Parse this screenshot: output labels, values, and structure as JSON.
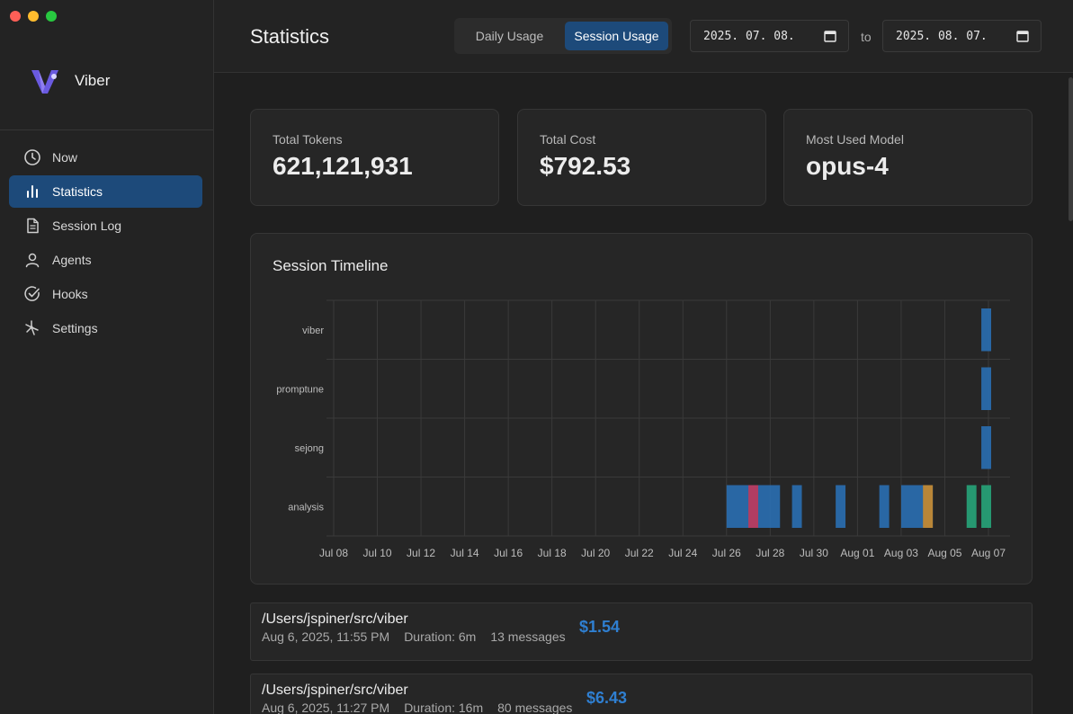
{
  "app": {
    "name": "Viber"
  },
  "sidebar": {
    "items": [
      {
        "label": "Now",
        "icon": "clock-icon",
        "active": false
      },
      {
        "label": "Statistics",
        "icon": "bar-chart-icon",
        "active": true
      },
      {
        "label": "Session Log",
        "icon": "document-icon",
        "active": false
      },
      {
        "label": "Agents",
        "icon": "user-icon",
        "active": false
      },
      {
        "label": "Hooks",
        "icon": "check-circle-icon",
        "active": false
      },
      {
        "label": "Settings",
        "icon": "settings-icon",
        "active": false
      }
    ]
  },
  "header": {
    "title": "Statistics",
    "tabs": [
      {
        "label": "Daily Usage",
        "active": false
      },
      {
        "label": "Session Usage",
        "active": true
      }
    ],
    "date_from": "2025. 07. 08.",
    "date_to": "2025. 08. 07.",
    "to_label": "to"
  },
  "cards": [
    {
      "label": "Total Tokens",
      "value": "621,121,931"
    },
    {
      "label": "Total Cost",
      "value": "$792.53"
    },
    {
      "label": "Most Used Model",
      "value": "opus-4"
    }
  ],
  "colors": {
    "accent": "#1d4a7a",
    "session_blue": "#2a6fb3",
    "session_teal": "#27a57a",
    "session_red": "#c0395b",
    "session_orange": "#c98a2c"
  },
  "chart_data": {
    "type": "timeline",
    "title": "Session Timeline",
    "projects": [
      "viber",
      "promptune",
      "sejong",
      "analysis"
    ],
    "x_ticks": [
      "Jul 08",
      "Jul 10",
      "Jul 12",
      "Jul 14",
      "Jul 16",
      "Jul 18",
      "Jul 20",
      "Jul 22",
      "Jul 24",
      "Jul 26",
      "Jul 28",
      "Jul 30",
      "Aug 01",
      "Aug 03",
      "Aug 05",
      "Aug 07"
    ],
    "xlim": [
      "2025-07-08",
      "2025-08-07"
    ],
    "grid": true,
    "sessions": [
      {
        "project": "viber",
        "start": "2025-08-07",
        "end": "2025-08-07",
        "color": "blue"
      },
      {
        "project": "promptune",
        "start": "2025-08-07",
        "end": "2025-08-07",
        "color": "blue"
      },
      {
        "project": "sejong",
        "start": "2025-08-07",
        "end": "2025-08-07",
        "color": "blue"
      },
      {
        "project": "analysis",
        "start": "2025-07-26",
        "end": "2025-07-28",
        "color": "blue"
      },
      {
        "project": "analysis",
        "start": "2025-07-27",
        "end": "2025-07-27",
        "color": "red"
      },
      {
        "project": "analysis",
        "start": "2025-07-29",
        "end": "2025-07-29",
        "color": "blue"
      },
      {
        "project": "analysis",
        "start": "2025-07-31",
        "end": "2025-07-31",
        "color": "blue"
      },
      {
        "project": "analysis",
        "start": "2025-08-02",
        "end": "2025-08-02",
        "color": "blue"
      },
      {
        "project": "analysis",
        "start": "2025-08-03",
        "end": "2025-08-04",
        "color": "blue"
      },
      {
        "project": "analysis",
        "start": "2025-08-04",
        "end": "2025-08-04",
        "color": "orange"
      },
      {
        "project": "analysis",
        "start": "2025-08-06",
        "end": "2025-08-06",
        "color": "teal"
      },
      {
        "project": "analysis",
        "start": "2025-08-07",
        "end": "2025-08-07",
        "color": "teal"
      }
    ]
  },
  "sessions": [
    {
      "path": "/Users/jspiner/src/viber",
      "date": "Aug 6, 2025, 11:55 PM",
      "duration": "Duration: 6m",
      "messages": "13 messages",
      "cost": "$1.54"
    },
    {
      "path": "/Users/jspiner/src/viber",
      "date": "Aug 6, 2025, 11:27 PM",
      "duration": "Duration: 16m",
      "messages": "80 messages",
      "cost": "$6.43"
    }
  ]
}
